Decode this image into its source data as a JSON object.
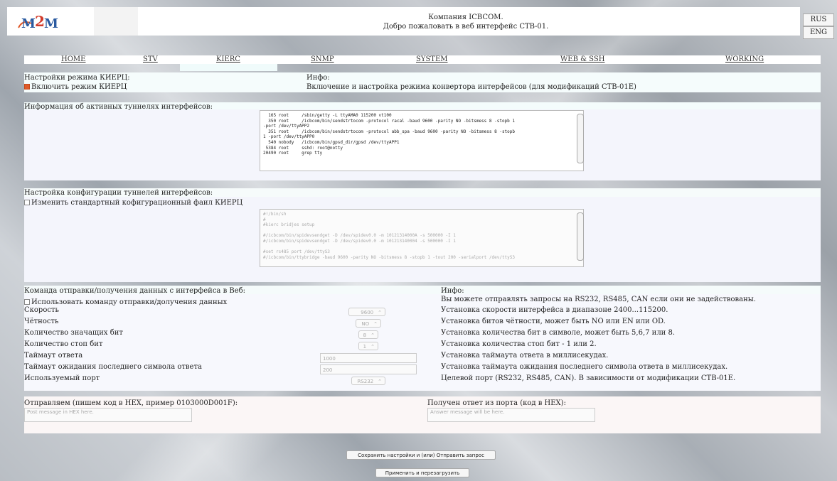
{
  "header": {
    "logo_text": "M2M",
    "company": "Компания ICBCOM.",
    "welcome": "Добро пожаловать в веб интерфейс СТВ-01.",
    "lang_rus": "RUS",
    "lang_eng": "ENG"
  },
  "nav": {
    "items": [
      "HOME",
      "STV",
      "KIERC",
      "SNMP",
      "SYSTEM",
      "WEB & SSH",
      "WORKING"
    ],
    "active": "KIERC"
  },
  "kierc": {
    "title": "Настройки режима КИЕРЦ:",
    "enable_label": "Включить режим КИЕРЦ",
    "info_title": "Инфо:",
    "info_text": "Включение и настройка режима конвертора интерфейсов (для модификаций СТВ-01Е)"
  },
  "tunnels": {
    "title": "Информация об активных туннелях интерфейсов:",
    "text": "  165 root     /sbin/getty -L ttyAMA0 115200 vt100\n  350 root     /icbcom/bin/sendstrtocom -protocol racal -baud 9600 -parity NO -bitsmess 8 -stopb 1\n-port /dev/ttyAPP2\n  351 root     /icbcom/bin/sendstrtocom -protocol abb_spa -baud 9600 -parity NO -bitsmess 8 -stopb\n1 -port /dev/ttyAPP0\n  540 nobody   /icbcom/bin/gpsd_dir/gpsd /dev/ttyAPP1\n 5384 root     sshd: root@notty\n20490 root     grep tty"
  },
  "config": {
    "title": "Настройка конфигурации туннелей интерфейсов:",
    "change_label": "Изменить стандартный кофигурационный фаил КИЕРЦ",
    "text": "#!/bin/sh\n#\n#kierc bridjes setup\n\n#/icbcom/bin/spidevsendget -D /dev/spidev0.0 -m 10121314000A -s 500000 -I 1\n#/icbcom/bin/spidevsendget -D /dev/spidev0.0 -m 101213140004 -s 500000 -I 1\n\n#set rs485 port /dev/ttyS3\n#/icbcom/bin/ttybridge -baud 9600 -parity NO -bitsmess 8 -stopb 1 -tout 200 -serialport /dev/ttyS3"
  },
  "command": {
    "title": "Команда отправки/получения данных с интерфейса в Веб:",
    "use_label": "Использовать команду отправки/долучения данных",
    "info_title": "Инфо:",
    "info_intro": "Вы можете отправлять запросы на RS232, RS485, CAN если они не задействованы.",
    "rows": [
      {
        "label": "Скорость",
        "value": "9600",
        "info": "Установка скорости интерфейса в диапазоне 2400...115200."
      },
      {
        "label": "Чётность",
        "value": "NO",
        "info": "Установка битов чётности, может быть NO или EN или OD."
      },
      {
        "label": "Количество значащих бит",
        "value": "8",
        "info": "Установка количества бит в символе, может быть 5,6,7 или 8."
      },
      {
        "label": "Количество стоп бит",
        "value": "1",
        "info": "Установка количества стоп бит - 1 или 2."
      },
      {
        "label": "Таймаут ответа",
        "value": "1000",
        "info": "Установка таймаута ответа в миллисекудах."
      },
      {
        "label": "Таймаут ожидания последнего символа ответа",
        "value": "200",
        "info": "Установка таймаута ожидания последнего символа ответа в миллисекудах."
      },
      {
        "label": "Используемый порт",
        "value": "RS232",
        "info": "Целевой порт (RS232, RS485, CAN). В зависимости от модификации СТВ-01Е."
      }
    ]
  },
  "hex": {
    "send_label": "Отправляем (пишем код в HEX, пример 0103000D001F):",
    "send_placeholder": "Post message in HEX here.",
    "recv_label": "Получен ответ из порта (код в HEX):",
    "recv_placeholder": "Answer message will be here."
  },
  "buttons": {
    "save": "Сохранить настройки и (или) Отправить запрос",
    "apply": "Применить и перезагрузить"
  }
}
